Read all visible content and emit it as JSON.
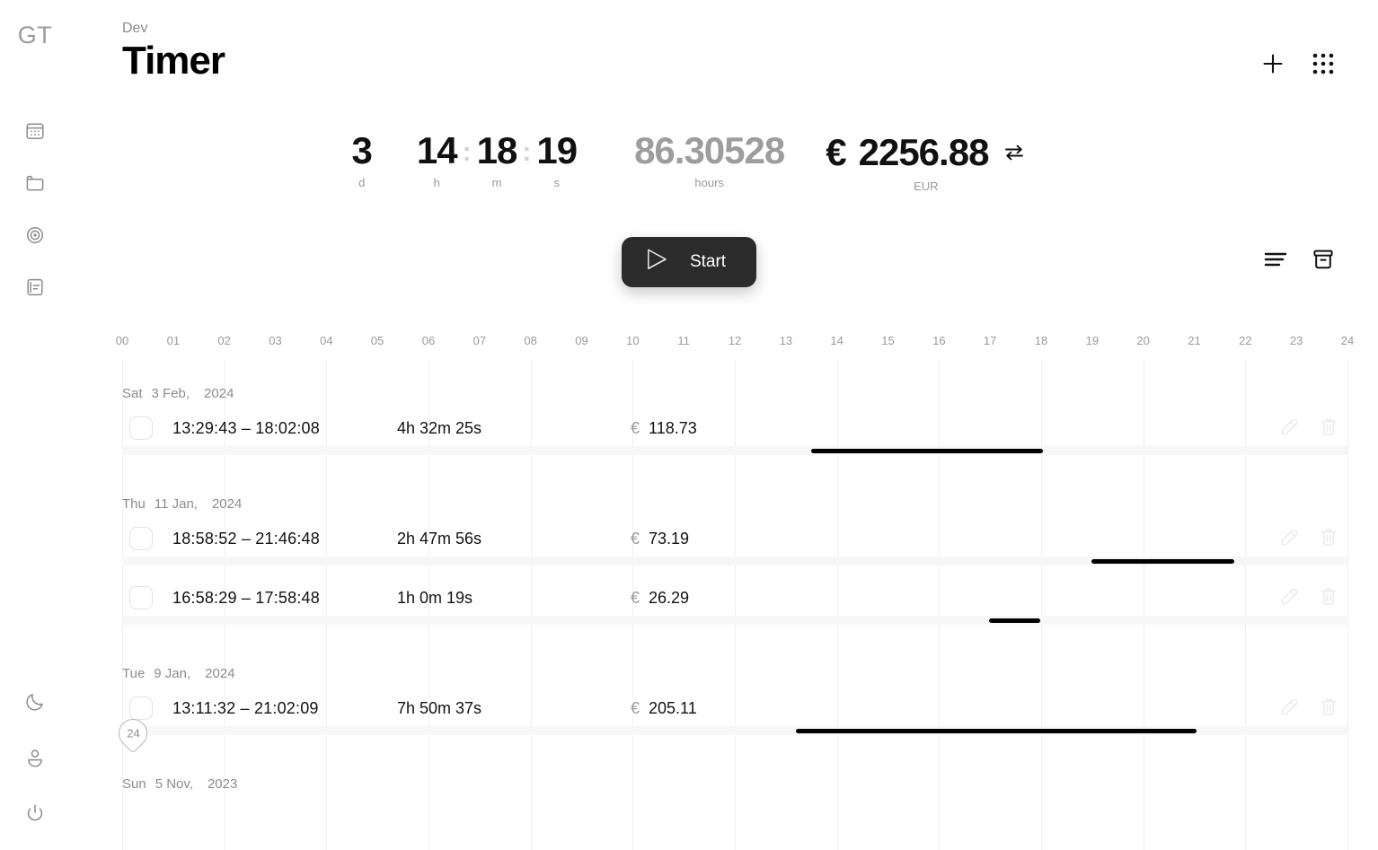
{
  "brand": {
    "logo": "GT"
  },
  "header": {
    "breadcrumb": "Dev",
    "title": "Timer",
    "add_label": "+",
    "apps_label": "apps"
  },
  "readout": {
    "days": {
      "value": "3",
      "unit": "d"
    },
    "hours": {
      "value": "14",
      "unit": "h"
    },
    "minutes": {
      "value": "18",
      "unit": "m"
    },
    "seconds": {
      "value": "19",
      "unit": "s"
    },
    "separator": ":",
    "decimal_hours": {
      "value": "86.30528",
      "unit": "hours"
    },
    "money": {
      "currency_symbol": "€",
      "value": "2256.88",
      "unit": "EUR"
    }
  },
  "start_button": {
    "label": "Start"
  },
  "view_tools": {
    "list_label": "list-view",
    "archive_label": "archive"
  },
  "timeline": {
    "hours": [
      "00",
      "01",
      "02",
      "03",
      "04",
      "05",
      "06",
      "07",
      "08",
      "09",
      "10",
      "11",
      "12",
      "13",
      "14",
      "15",
      "16",
      "17",
      "18",
      "19",
      "20",
      "21",
      "22",
      "23",
      "24"
    ],
    "axis_min": 0,
    "axis_max": 24,
    "cut_badge": "24"
  },
  "groups": [
    {
      "dow": "Sat",
      "date": "3 Feb,",
      "year": "2024",
      "entries": [
        {
          "start": "13:29:43",
          "dash": "–",
          "end": "18:02:08",
          "times": "13:29:43  –  18:02:08",
          "duration": "4h 32m 25s",
          "currency": "€",
          "amount": "118.73",
          "bar_start_hour": 13.4958,
          "bar_end_hour": 18.0356
        }
      ]
    },
    {
      "dow": "Thu",
      "date": "11 Jan,",
      "year": "2024",
      "entries": [
        {
          "start": "18:58:52",
          "dash": "–",
          "end": "21:46:48",
          "times": "18:58:52  –  21:46:48",
          "duration": "2h 47m 56s",
          "currency": "€",
          "amount": "73.19",
          "bar_start_hour": 18.9811,
          "bar_end_hour": 21.78
        },
        {
          "start": "16:58:29",
          "dash": "–",
          "end": "17:58:48",
          "times": "16:58:29  –  17:58:48",
          "duration": "1h 0m 19s",
          "currency": "€",
          "amount": "26.29",
          "bar_start_hour": 16.9747,
          "bar_end_hour": 17.98
        }
      ]
    },
    {
      "dow": "Tue",
      "date": "9 Jan,",
      "year": "2024",
      "entries": [
        {
          "start": "13:11:32",
          "dash": "–",
          "end": "21:02:09",
          "times": "13:11:32  –  21:02:09",
          "duration": "7h 50m 37s",
          "currency": "€",
          "amount": "205.11",
          "bar_start_hour": 13.1922,
          "bar_end_hour": 21.0358
        }
      ]
    },
    {
      "dow": "Sun",
      "date": "5 Nov,",
      "year": "2023",
      "entries": []
    }
  ],
  "colors": {
    "accent": "#2b2b2b",
    "bar": "#000000",
    "muted": "#9a9a9a",
    "grid": "#f0f0f0",
    "track": "#f7f7f7"
  }
}
